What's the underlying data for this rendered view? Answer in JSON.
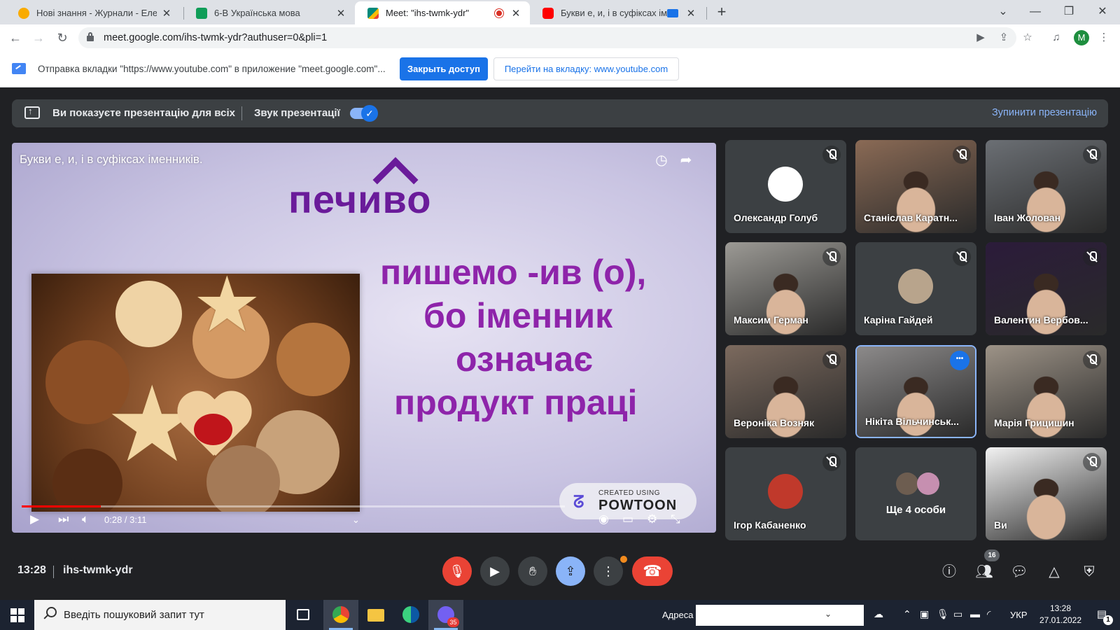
{
  "browser": {
    "tabs": [
      {
        "title": "Нові знання - Журнали - Електр",
        "favicon": "sun-icon",
        "favicon_color": "#f9ab00",
        "active": false
      },
      {
        "title": "6-В Українська мова",
        "favicon": "classroom-icon",
        "favicon_color": "#0f9d58",
        "active": false
      },
      {
        "title": "Meet: \"ihs-twmk-ydr\"",
        "favicon": "meet-icon",
        "favicon_color": "#00897b",
        "active": true
      },
      {
        "title": "Букви е, и, і в суфіксах імен",
        "favicon": "youtube-icon",
        "favicon_color": "#ff0000",
        "active": false
      }
    ],
    "new_tab_glyph": "+",
    "url": "meet.google.com/ihs-twmk-ydr?authuser=0&pli=1",
    "profile_initial": "M"
  },
  "infobar": {
    "message": "Отправка вкладки \"https://www.youtube.com\" в приложение \"meet.google.com\"...",
    "stop_button": "Закрыть доступ",
    "goto_button": "Перейти на вкладку: www.youtube.com"
  },
  "meet": {
    "presenting_banner": "Ви показуєте презентацію для всіх",
    "sound_label": "Звук презентації",
    "sound_enabled": true,
    "stop_presenting": "Зупинити презентацію",
    "video": {
      "title": "Букви е, и, і в суфіксах іменників.",
      "brand_word": "печиво",
      "slide_lines": [
        "пишемо -ив (о),",
        "бо іменник",
        "означає",
        "продукт праці"
      ],
      "powtoon_small": "CREATED USING",
      "powtoon_big": "POWTOON",
      "time_display": "0:28 / 3:11",
      "progress_fraction": 0.146
    },
    "participants": [
      {
        "name": "Олександр Голуб",
        "muted": true,
        "camera": false,
        "avatar_color": "#ffffff"
      },
      {
        "name": "Станіслав Каратн...",
        "muted": true,
        "camera": true,
        "scene_color": "#8a6a55"
      },
      {
        "name": "Іван Жолован",
        "muted": true,
        "camera": true,
        "scene_color": "#6b6f74"
      },
      {
        "name": "Максим Герман",
        "muted": true,
        "camera": true,
        "scene_color": "#9c9a95"
      },
      {
        "name": "Каріна Гайдей",
        "muted": true,
        "camera": false,
        "avatar_color": "#b8a48c"
      },
      {
        "name": "Валентин Вербов...",
        "muted": true,
        "camera": true,
        "scene_color": "#2b1b3a"
      },
      {
        "name": "Вероніка Возняк",
        "muted": true,
        "camera": true,
        "scene_color": "#7c6a5e"
      },
      {
        "name": "Нікіта Вільчинськ...",
        "muted": false,
        "camera": true,
        "selected": true,
        "scene_color": "#8c8a8a"
      },
      {
        "name": "Марія Грицишин",
        "muted": true,
        "camera": true,
        "scene_color": "#9d9387"
      },
      {
        "name": "Ігор Кабаненко",
        "muted": true,
        "camera": false,
        "avatar_color": "#c0392b"
      },
      {
        "more_label": "Ще 4 особи"
      },
      {
        "name": "Ви",
        "muted": true,
        "camera": true,
        "scene_color": "#f2f2f2"
      }
    ],
    "meeting_time": "13:28",
    "meeting_code": "ihs-twmk-ydr",
    "people_count": "16"
  },
  "taskbar": {
    "search_placeholder": "Введіть пошуковий запит тут",
    "address_label": "Адреса",
    "viber_badge": "35",
    "language": "УКР",
    "clock_time": "13:28",
    "clock_date": "27.01.2022",
    "notification_count": "1"
  },
  "colors": {
    "meet_bg": "#202124",
    "accent_blue": "#1a73e8",
    "danger_red": "#ea4335",
    "slide_purple": "#8e24aa"
  }
}
